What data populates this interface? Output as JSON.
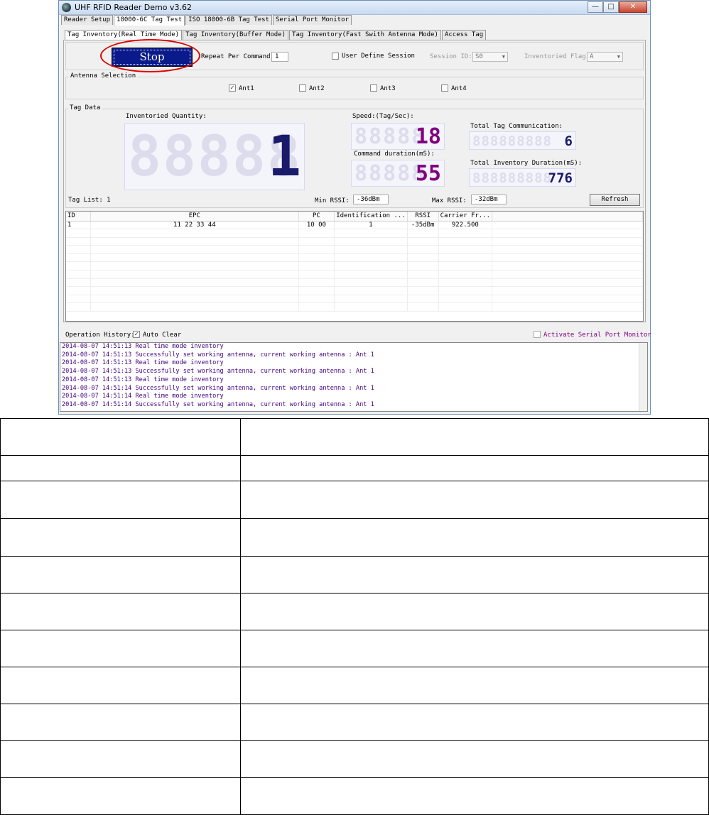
{
  "window": {
    "title": "UHF RFID Reader Demo v3.62",
    "buttons": [
      "—",
      "□",
      "✕"
    ]
  },
  "main_tabs": [
    "Reader Setup",
    "18000-6C Tag Test",
    "ISO 18000-6B Tag Test",
    "Serial Port Monitor"
  ],
  "sub_tabs": [
    "Tag Inventory(Real Time Mode)",
    "Tag Inventory(Buffer Mode)",
    "Tag Inventory(Fast Swith Antenna Mode)",
    "Access Tag"
  ],
  "controls": {
    "stop_label": "Stop",
    "repeat_label": "Repeat Per Command:",
    "repeat_value": "1",
    "user_define_session_label": "User Define Session",
    "session_id_label": "Session ID:",
    "session_id_value": "S0",
    "inventoried_flag_label": "Inventoried Flag:",
    "inventoried_flag_value": "A"
  },
  "antenna": {
    "title": "Antenna Selection",
    "items": [
      {
        "label": "Ant1",
        "checked": true
      },
      {
        "label": "Ant2",
        "checked": false
      },
      {
        "label": "Ant3",
        "checked": false
      },
      {
        "label": "Ant4",
        "checked": false
      }
    ]
  },
  "tag_data": {
    "title": "Tag Data",
    "inventoried_quantity_label": "Inventoried Quantity:",
    "inventoried_quantity": "1",
    "speed_label": "Speed:(Tag/Sec):",
    "speed": "18",
    "command_duration_label": "Command duration(mS):",
    "command_duration": "55",
    "total_tag_comm_label": "Total Tag Communication:",
    "total_tag_comm": "6",
    "total_inventory_duration_label": "Total Inventory Duration(mS):",
    "total_inventory_duration": "776"
  },
  "tag_list": {
    "label": "Tag List: 1",
    "min_rssi_label": "Min RSSI:",
    "min_rssi": "-36dBm",
    "max_rssi_label": "Max RSSI:",
    "max_rssi": "-32dBm",
    "refresh_label": "Refresh",
    "columns": [
      "ID",
      "EPC",
      "PC",
      "Identification ...",
      "RSSI",
      "Carrier Fr..."
    ],
    "rows": [
      [
        "1",
        "11 22 33 44",
        "10 00",
        "1",
        "-35dBm",
        "922.500"
      ]
    ]
  },
  "history": {
    "label": "Operation History:",
    "auto_clear_label": "Auto Clear",
    "activate_monitor_label": "Activate Serial Port Monitor",
    "lines": [
      "2014-08-07 14:51:13 Real time mode inventory",
      "2014-08-07 14:51:13 Successfully set working antenna, current working antenna : Ant 1",
      "2014-08-07 14:51:13 Real time mode inventory",
      "2014-08-07 14:51:13 Successfully set working antenna, current working antenna : Ant 1",
      "2014-08-07 14:51:13 Real time mode inventory",
      "2014-08-07 14:51:14 Successfully set working antenna, current working antenna : Ant 1",
      "2014-08-07 14:51:14 Real time mode inventory",
      "2014-08-07 14:51:14 Successfully set working antenna, current working antenna : Ant 1"
    ]
  },
  "colors": {
    "stop_bg": "#0a1a8a",
    "highlight_ring": "#e00000",
    "digit_dark": "#1a1a6a",
    "digit_purple": "#800080"
  }
}
